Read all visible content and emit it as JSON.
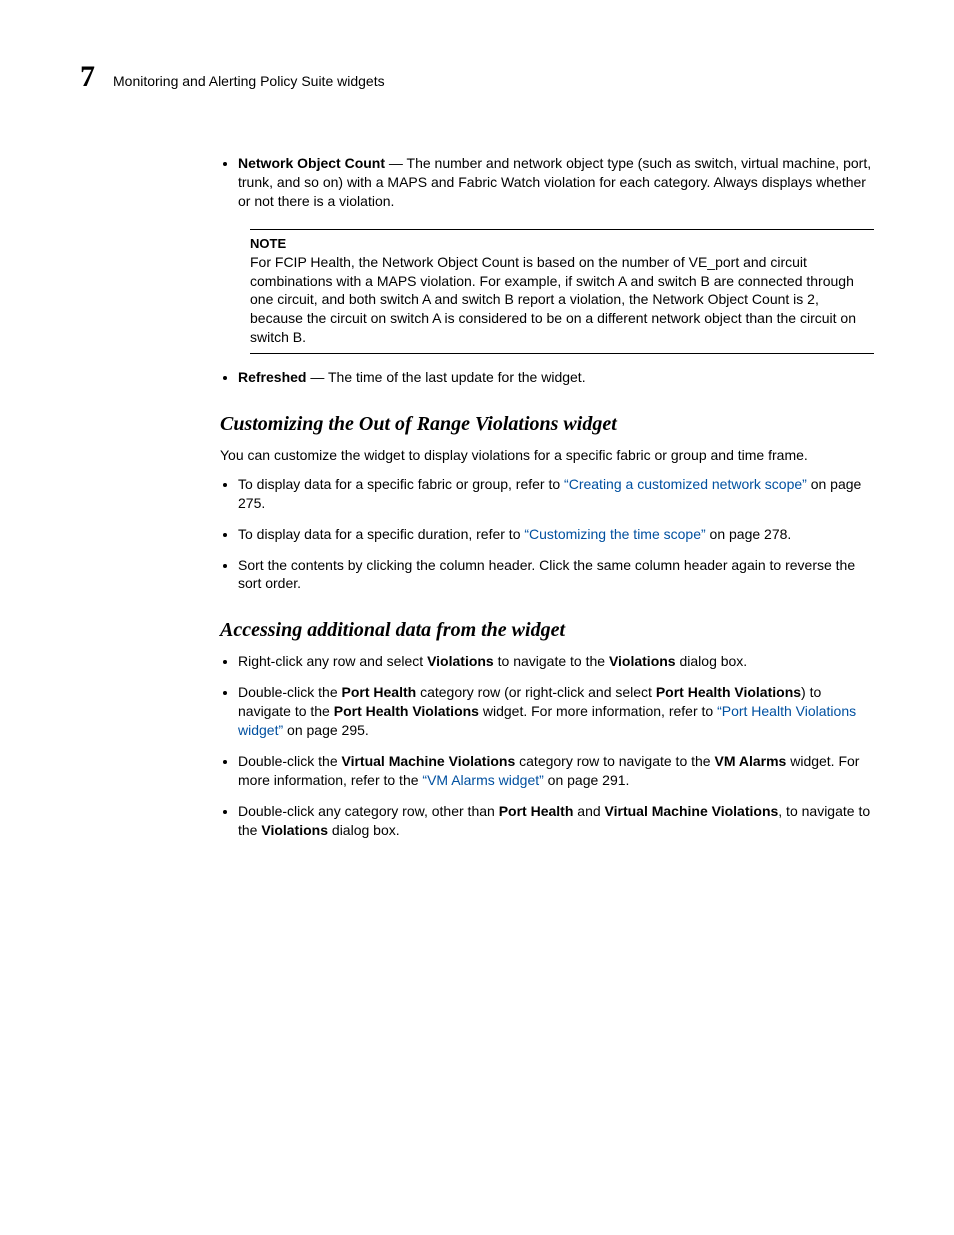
{
  "header": {
    "chapter_number": "7",
    "running_title": "Monitoring and Alerting Policy Suite widgets"
  },
  "bullets_top": {
    "item1_bold": "Network Object Count",
    "item1_rest": " — The number and network object type (such as switch, virtual machine, port, trunk, and so on) with a MAPS and Fabric Watch violation for each category. Always displays whether or not there is a violation."
  },
  "note": {
    "heading": "NOTE",
    "body": "For FCIP Health, the Network Object Count is based on the number of VE_port and circuit combinations with a MAPS violation. For example, if switch A and switch B are connected through one circuit, and both switch A and switch B report a violation, the Network Object Count is 2, because the circuit on switch A is considered to be on a different network object than the circuit on switch B."
  },
  "bullets_after_note": {
    "item1_bold": "Refreshed",
    "item1_rest": " — The time of the last update for the widget."
  },
  "section1": {
    "heading": "Customizing the Out of Range Violations widget",
    "intro": "You can customize the widget to display violations for a specific fabric or group and time frame.",
    "b1_pre": "To display data for a specific fabric or group, refer to ",
    "b1_link": "“Creating a customized network scope”",
    "b1_post": " on page 275.",
    "b2_pre": "To display data for a specific duration, refer to ",
    "b2_link": "“Customizing the time scope”",
    "b2_post": " on page 278.",
    "b3": "Sort the contents by clicking the column header. Click the same column header again to reverse the sort order."
  },
  "section2": {
    "heading": "Accessing additional data from the widget",
    "r1_pre": "Right-click any row and select ",
    "r1_bold1": "Violations",
    "r1_mid": " to navigate to the ",
    "r1_bold2": "Violations",
    "r1_post": " dialog box.",
    "r2_pre": "Double-click the ",
    "r2_bold1": "Port Health",
    "r2_mid1": " category row (or right-click and select ",
    "r2_bold2": "Port Health Violations",
    "r2_mid2": ") to navigate to the ",
    "r2_bold3": "Port Health Violations",
    "r2_mid3": " widget. For more information, refer to ",
    "r2_link": "“Port Health Violations widget”",
    "r2_post": " on page 295.",
    "r3_pre": "Double-click the ",
    "r3_bold1": "Virtual Machine Violations",
    "r3_mid1": " category row to navigate to the ",
    "r3_bold2": "VM Alarms",
    "r3_mid2": " widget. For more information, refer to the ",
    "r3_link": "“VM Alarms widget”",
    "r3_post": " on page 291.",
    "r4_pre": "Double-click any category row, other than ",
    "r4_bold1": "Port Health",
    "r4_mid1": " and ",
    "r4_bold2": "Virtual Machine Violations",
    "r4_mid2": ", to navigate to the ",
    "r4_bold3": "Violations",
    "r4_post": " dialog box."
  }
}
